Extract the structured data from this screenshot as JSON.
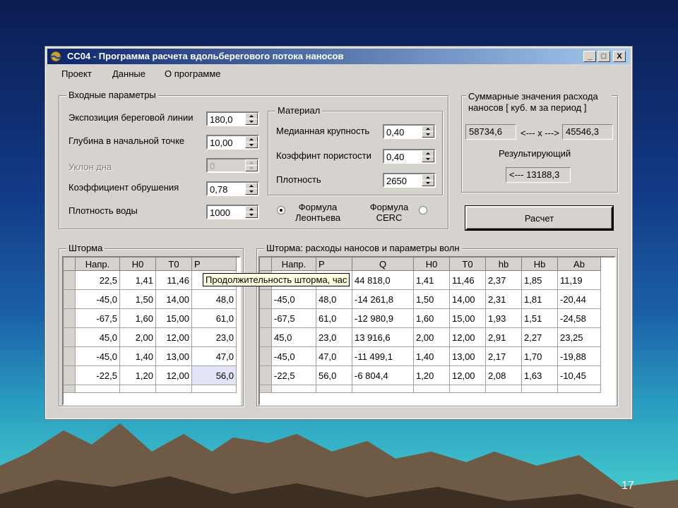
{
  "colors": {
    "titlebar_start": "#0a246a",
    "titlebar_end": "#a6caf0",
    "window_face": "#d6d3ce",
    "tooltip_bg": "#ffffe1"
  },
  "window": {
    "title": "CC04 - Программа расчета вдольберегового потока наносов",
    "buttons": {
      "minimize": "_",
      "maximize": "□",
      "close": "X"
    }
  },
  "menu": [
    "Проект",
    "Данные",
    "О программе"
  ],
  "input_params": {
    "title": "Входные параметры",
    "rows": [
      {
        "label": "Экспозиция береговой линии",
        "value": "180,0",
        "disabled": false
      },
      {
        "label": "Глубина в начальной точке",
        "value": "10,00",
        "disabled": false
      },
      {
        "label": "Уклон дна",
        "value": "0",
        "disabled": true
      },
      {
        "label": "Коэффициент обрушения",
        "value": "0,78",
        "disabled": false
      },
      {
        "label": "Плотность воды",
        "value": "1000",
        "disabled": false
      }
    ]
  },
  "material": {
    "title": "Материал",
    "rows": [
      {
        "label": "Медианная крупность",
        "value": "0,40"
      },
      {
        "label": "Коэффинт пористости",
        "value": "0,40"
      },
      {
        "label": "Плотность",
        "value": "2650"
      }
    ]
  },
  "formula": {
    "leontiev": {
      "label": "Формула Леонтьева",
      "selected": true
    },
    "cerc": {
      "label": "Формула CERC",
      "selected": false
    }
  },
  "summary": {
    "title": "Суммарные значения расхода наносов [ куб. м за период ]",
    "left_value": "58734,6",
    "arrow": "<--- x --->",
    "right_value": "45546,3",
    "result_label": "Результирующий",
    "result_value": "<--- 13188,3"
  },
  "calc_button": "Расчет",
  "storms": {
    "title": "Шторма",
    "headers": [
      "Напр.",
      "H0",
      "T0",
      "P"
    ],
    "rows": [
      [
        "22,5",
        "1,41",
        "11,46",
        ""
      ],
      [
        "-45,0",
        "1,50",
        "14,00",
        "48,0"
      ],
      [
        "-67,5",
        "1,60",
        "15,00",
        "61,0"
      ],
      [
        "45,0",
        "2,00",
        "12,00",
        "23,0"
      ],
      [
        "-45,0",
        "1,40",
        "13,00",
        "47,0"
      ],
      [
        "-22,5",
        "1,20",
        "12,00",
        "56,0"
      ]
    ]
  },
  "tooltip": "Продолжительность шторма, час",
  "results": {
    "title": "Шторма: расходы наносов и параметры волн",
    "headers": [
      "Напр.",
      "P",
      "Q",
      "H0",
      "T0",
      "hb",
      "Hb",
      "Ab"
    ],
    "rows": [
      [
        "",
        "",
        "44 818,0",
        "1,41",
        "11,46",
        "2,37",
        "1,85",
        "11,19"
      ],
      [
        "-45,0",
        "48,0",
        "-14 261,8",
        "1,50",
        "14,00",
        "2,31",
        "1,81",
        "-20,44"
      ],
      [
        "-67,5",
        "61,0",
        "-12 980,9",
        "1,60",
        "15,00",
        "1,93",
        "1,51",
        "-24,58"
      ],
      [
        "45,0",
        "23,0",
        "13 916,6",
        "2,00",
        "12,00",
        "2,91",
        "2,27",
        "23,25"
      ],
      [
        "-45,0",
        "47,0",
        "-11 499,1",
        "1,40",
        "13,00",
        "2,17",
        "1,70",
        "-19,88"
      ],
      [
        "-22,5",
        "56,0",
        "-6 804,4",
        "1,20",
        "12,00",
        "2,08",
        "1,63",
        "-10,45"
      ]
    ]
  },
  "slide_number": "17"
}
